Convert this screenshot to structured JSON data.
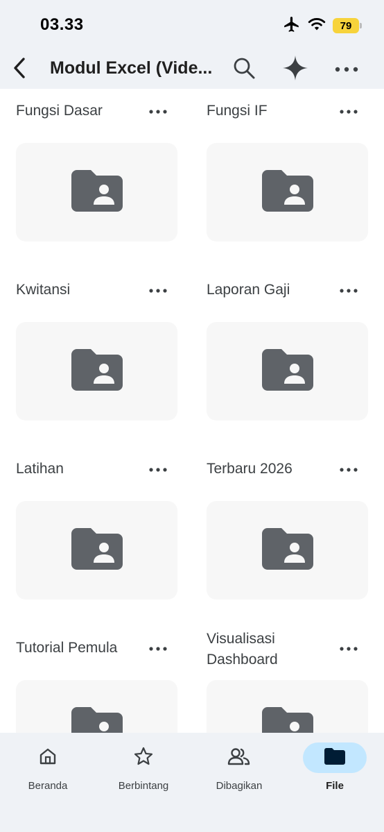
{
  "status_bar": {
    "time": "03.33",
    "battery": "79"
  },
  "top_bar": {
    "title": "Modul Excel (Vide..."
  },
  "folders": [
    {
      "name": "Fungsi Dasar"
    },
    {
      "name": "Fungsi IF"
    },
    {
      "name": "Kwitansi"
    },
    {
      "name": "Laporan Gaji"
    },
    {
      "name": "Latihan"
    },
    {
      "name": "Terbaru 2026"
    },
    {
      "name": "Tutorial Pemula"
    },
    {
      "name": "Visualisasi Dashboard"
    }
  ],
  "bottom_nav": [
    {
      "label": "Beranda",
      "icon": "home-icon"
    },
    {
      "label": "Berbintang",
      "icon": "star-icon"
    },
    {
      "label": "Dibagikan",
      "icon": "shared-people-icon"
    },
    {
      "label": "File",
      "icon": "folder-icon",
      "active": true
    }
  ],
  "colors": {
    "bar_background": "#eff2f6",
    "thumbnail_background": "#f7f7f7",
    "folder_icon": "#5f6368",
    "active_pill": "#c2e7ff",
    "active_icon": "#001d35",
    "battery": "#f7d33b"
  }
}
